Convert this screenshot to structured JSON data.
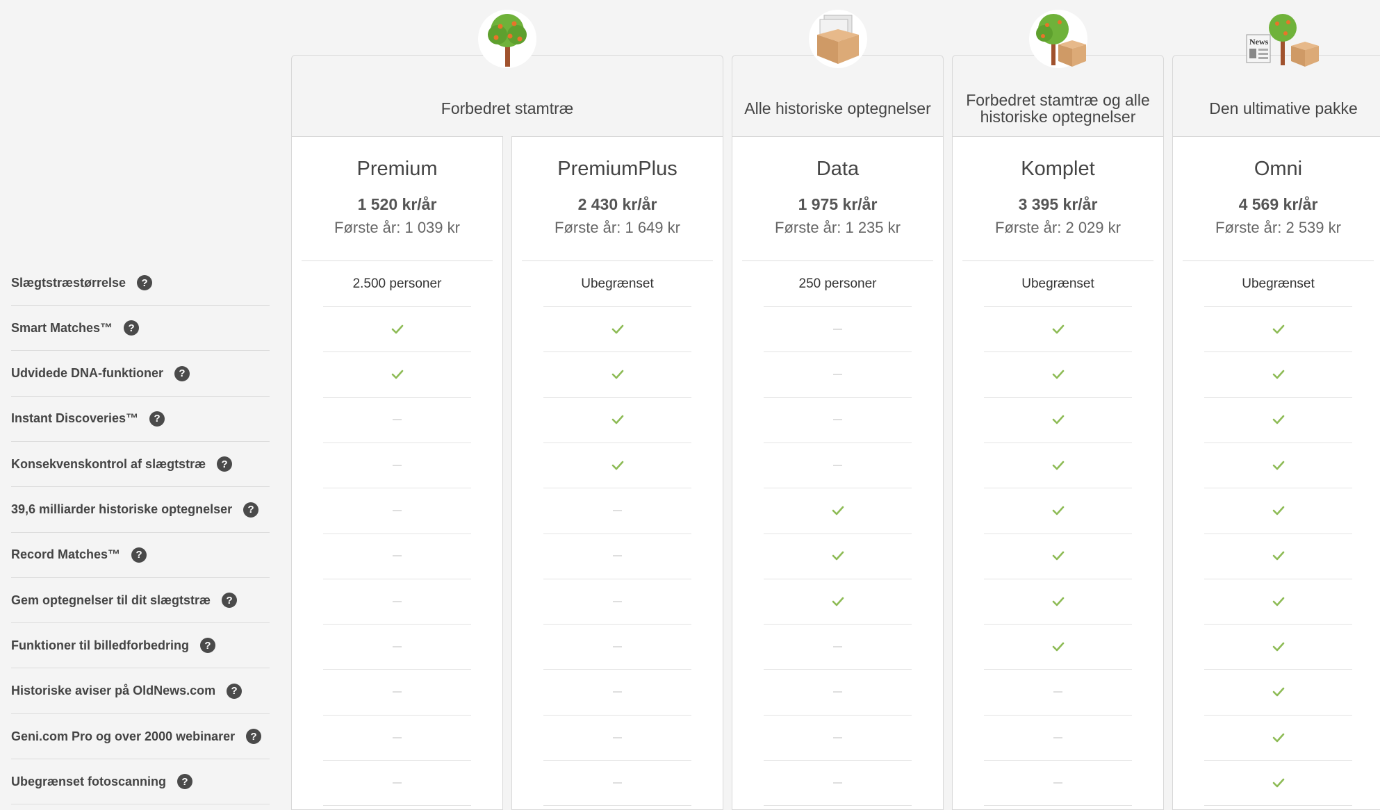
{
  "groups": [
    {
      "title": "Forbedret stamtræ",
      "icon": "tree-icon"
    },
    {
      "title": "Alle historiske optegnelser",
      "icon": "records-box-icon"
    },
    {
      "title": "Forbedret stamtræ og alle historiske optegnelser",
      "icon": "tree-and-box-icon"
    },
    {
      "title": "Den ultimative pakke",
      "icon": "news-tree-box-icon",
      "news_label": "News"
    }
  ],
  "plans": [
    {
      "name": "Premium",
      "price": "1 520 kr/år",
      "first_year": "Første år: 1 039 kr"
    },
    {
      "name": "PremiumPlus",
      "price": "2 430 kr/år",
      "first_year": "Første år: 1 649 kr"
    },
    {
      "name": "Data",
      "price": "1 975 kr/år",
      "first_year": "Første år: 1 235 kr"
    },
    {
      "name": "Komplet",
      "price": "3 395 kr/år",
      "first_year": "Første år: 2 029 kr"
    },
    {
      "name": "Omni",
      "price": "4 569 kr/år",
      "first_year": "Første år: 2 539 kr"
    }
  ],
  "features": [
    {
      "label": "Slægtstræstørrelse",
      "values": [
        "2.500 personer",
        "Ubegrænset",
        "250 personer",
        "Ubegrænset",
        "Ubegrænset"
      ]
    },
    {
      "label": "Smart Matches™",
      "values": [
        true,
        true,
        false,
        true,
        true
      ]
    },
    {
      "label": "Udvidede DNA-funktioner",
      "values": [
        true,
        true,
        false,
        true,
        true
      ]
    },
    {
      "label": "Instant Discoveries™",
      "values": [
        false,
        true,
        false,
        true,
        true
      ]
    },
    {
      "label": "Konsekvenskontrol af slægtstræ",
      "values": [
        false,
        true,
        false,
        true,
        true
      ]
    },
    {
      "label": "39,6 milliarder historiske optegnelser",
      "values": [
        false,
        false,
        true,
        true,
        true
      ]
    },
    {
      "label": "Record Matches™",
      "values": [
        false,
        false,
        true,
        true,
        true
      ]
    },
    {
      "label": "Gem optegnelser til dit slægtstræ",
      "values": [
        false,
        false,
        true,
        true,
        true
      ]
    },
    {
      "label": "Funktioner til billedforbedring",
      "values": [
        false,
        false,
        false,
        true,
        true
      ]
    },
    {
      "label": "Historiske aviser på OldNews.com",
      "values": [
        false,
        false,
        false,
        false,
        true
      ]
    },
    {
      "label": "Geni.com Pro og over 2000 webinarer",
      "values": [
        false,
        false,
        false,
        false,
        true
      ]
    },
    {
      "label": "Ubegrænset fotoscanning",
      "values": [
        false,
        false,
        false,
        false,
        true
      ]
    }
  ],
  "help_glyph": "?",
  "colors": {
    "check": "#8dbb55",
    "dash": "#dedede",
    "help_bg": "#4a4a4a"
  }
}
